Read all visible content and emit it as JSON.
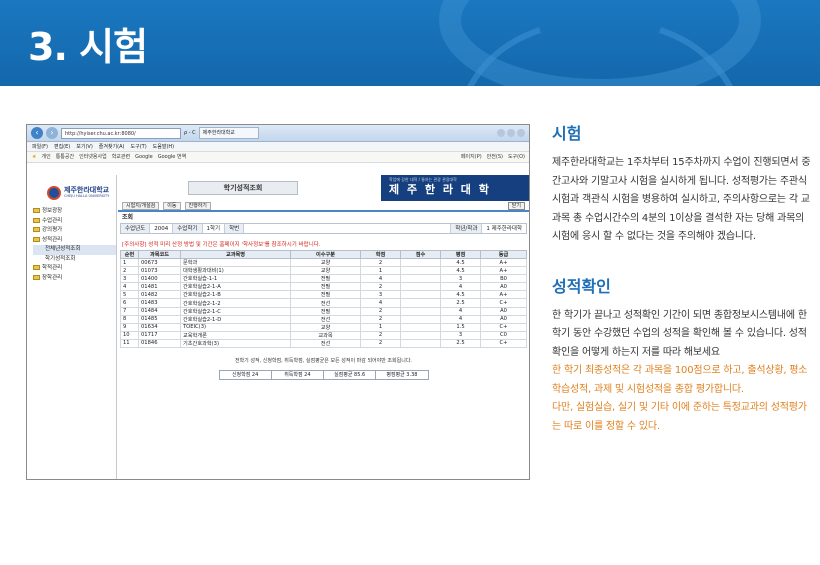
{
  "header": {
    "title": "3. 시험",
    "banner_color": "#1670b6"
  },
  "browser": {
    "address": "http://hyiser.chu.ac.kr:8080/",
    "address_icons": "ρ - C",
    "tab_label": "제주한라대학교",
    "menu": [
      "파일(F)",
      "편집(E)",
      "보기(V)",
      "즐겨찾기(A)",
      "도구(T)",
      "도움말(H)"
    ],
    "favorites": [
      "개인",
      "통통공간",
      "인터넷용사업",
      "학교관련",
      "Google",
      "Google 번역"
    ],
    "toolbar_right": [
      "페이지(P)",
      "안전(S)",
      "도구(O)"
    ]
  },
  "app": {
    "logo_title": "제주한라대학교",
    "logo_sub": "CHEJU HALLA UNIVERSITY",
    "tree": [
      {
        "label": "정보광장",
        "level": 0
      },
      {
        "label": "수업관리",
        "level": 1
      },
      {
        "label": "강의평가",
        "level": 1
      },
      {
        "label": "성적관리",
        "level": 1
      },
      {
        "label": "전체년성적조회",
        "level": 2,
        "selected": true
      },
      {
        "label": "학기성적조회",
        "level": 2
      },
      {
        "label": "학적관리",
        "level": 1
      },
      {
        "label": "장학관리",
        "level": 1
      }
    ],
    "page_title": "학기성적조회",
    "univ_small": "학업에 강한 대학 / 통하는 관광 관광대학",
    "univ_big": "제 주 한 라 대 학",
    "subnav": [
      "시험지/개설검",
      "이동",
      "진행하기"
    ],
    "subnav_right": "닫기",
    "section": "조회",
    "filter": {
      "year_label": "수업년도",
      "year_value": "2004",
      "term_label": "수업학기",
      "term_value": "1학기",
      "id_label": "학번",
      "id_value": "",
      "dept_label": "학년/학과",
      "dept_value": "1 제주한라대학"
    },
    "notice": "[주의사항] 성적 미리 산정 방법 및 기간은 홈페이지 '학사정보'를 참조하시기 바랍니다.",
    "columns": [
      "순번",
      "과목코드",
      "교과목명",
      "이수구분",
      "학점",
      "점수",
      "평점",
      "등급"
    ],
    "rows": [
      [
        "1",
        "00673",
        "문학과",
        "교양",
        "2",
        "",
        "4.5",
        "A+"
      ],
      [
        "2",
        "01073",
        "대학생활과대비(1)",
        "교양",
        "1",
        "",
        "4.5",
        "A+"
      ],
      [
        "3",
        "01400",
        "간호학실습-1-1",
        "전필",
        "4",
        "",
        "3",
        "B0"
      ],
      [
        "4",
        "01481",
        "간호학실습2-1-A",
        "전필",
        "2",
        "",
        "4",
        "A0"
      ],
      [
        "5",
        "01482",
        "간호학실습2-1-B",
        "전필",
        "3",
        "",
        "4.5",
        "A+"
      ],
      [
        "6",
        "01483",
        "간호학실습2-1-2",
        "전선",
        "4",
        "",
        "2.5",
        "C+"
      ],
      [
        "7",
        "01484",
        "간호학실습2-1-C",
        "전필",
        "2",
        "",
        "4",
        "A0"
      ],
      [
        "8",
        "01485",
        "간호학실습2-1-D",
        "전선",
        "2",
        "",
        "4",
        "A0"
      ],
      [
        "9",
        "01634",
        "TOEIC(3)",
        "교양",
        "1",
        "",
        "1.5",
        "C+"
      ],
      [
        "10",
        "01717",
        "교육학개론",
        "교과목",
        "2",
        "",
        "3",
        "C0"
      ],
      [
        "11",
        "01846",
        "기초간호과학(3)",
        "전선",
        "2",
        "",
        "2.5",
        "C+"
      ]
    ],
    "footer_note": "전학기 성적, 신청학점, 취득학점, 실점평균은 모든 성적이 마감 되어야만 조회됩니다.",
    "footer_stats": [
      "신청학점 24",
      "취득학점 24",
      "실점평균 85.6",
      "평점평균 3.38"
    ]
  },
  "panel": {
    "exam_title": "시험",
    "exam_text": "제주한라대학교는 1주차부터 15주차까지 수업이 진행되면서 중간고사와 기말고사 시험을 실시하게 됩니다. 성적평가는 주관식 시험과 객관식 시험을 병용하여 실시하고, 주의사항으로는 각 교과목 총 수업시간수의 4분의 1이상을 결석한 자는 당해 과목의 시험에 응시 할 수 없다는 것을 주의해야 겠습니다.",
    "grade_title": "성적확인",
    "grade_text": "한 학기가 끝나고 성적확인 기간이 되면 종합정보시스템내에 한 학기 동안 수강했던 수업의 성적을 확인해 볼 수  있습니다. 성적확인을 어떻게 하는지 저를 따라 해보세요",
    "grade_orange1": "한 학기 최종성적은 각 과목을 100점으로 하고, 출석상황, 평소학습성적, 과제 및 시험성적을 종합 평가합니다.",
    "grade_orange2": "다만, 실험실습, 실기 및 기타 이에 준하는 특정교과의 성적평가는 따로 이를 정할 수 있다."
  }
}
